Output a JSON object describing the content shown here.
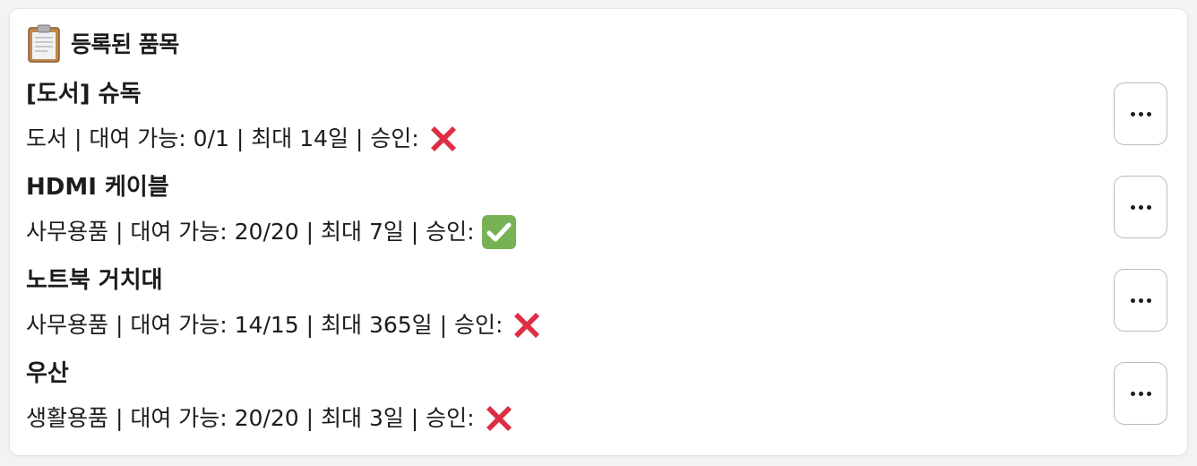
{
  "header": {
    "icon": "clipboard-icon",
    "title": "등록된 품목"
  },
  "items": [
    {
      "name": "[도서] 슈독",
      "meta": "도서 | 대여 가능: 0/1 | 최대 14일 | 승인:",
      "approval": "cross-mark-icon",
      "more_icon": "ellipsis-icon"
    },
    {
      "name": "HDMI 케이블",
      "meta": "사무용품 | 대여 가능: 20/20 | 최대 7일 | 승인:",
      "approval": "check-mark-icon",
      "more_icon": "ellipsis-icon"
    },
    {
      "name": "노트북 거치대",
      "meta": "사무용품 | 대여 가능: 14/15 | 최대 365일 | 승인:",
      "approval": "cross-mark-icon",
      "more_icon": "ellipsis-icon"
    },
    {
      "name": "우산",
      "meta": "생활용품 | 대여 가능: 20/20 | 최대 3일 | 승인:",
      "approval": "cross-mark-icon",
      "more_icon": "ellipsis-icon"
    }
  ],
  "colors": {
    "cross": "#dd2e44",
    "check_bg": "#77b255",
    "button_border": "#bcbcbc"
  }
}
